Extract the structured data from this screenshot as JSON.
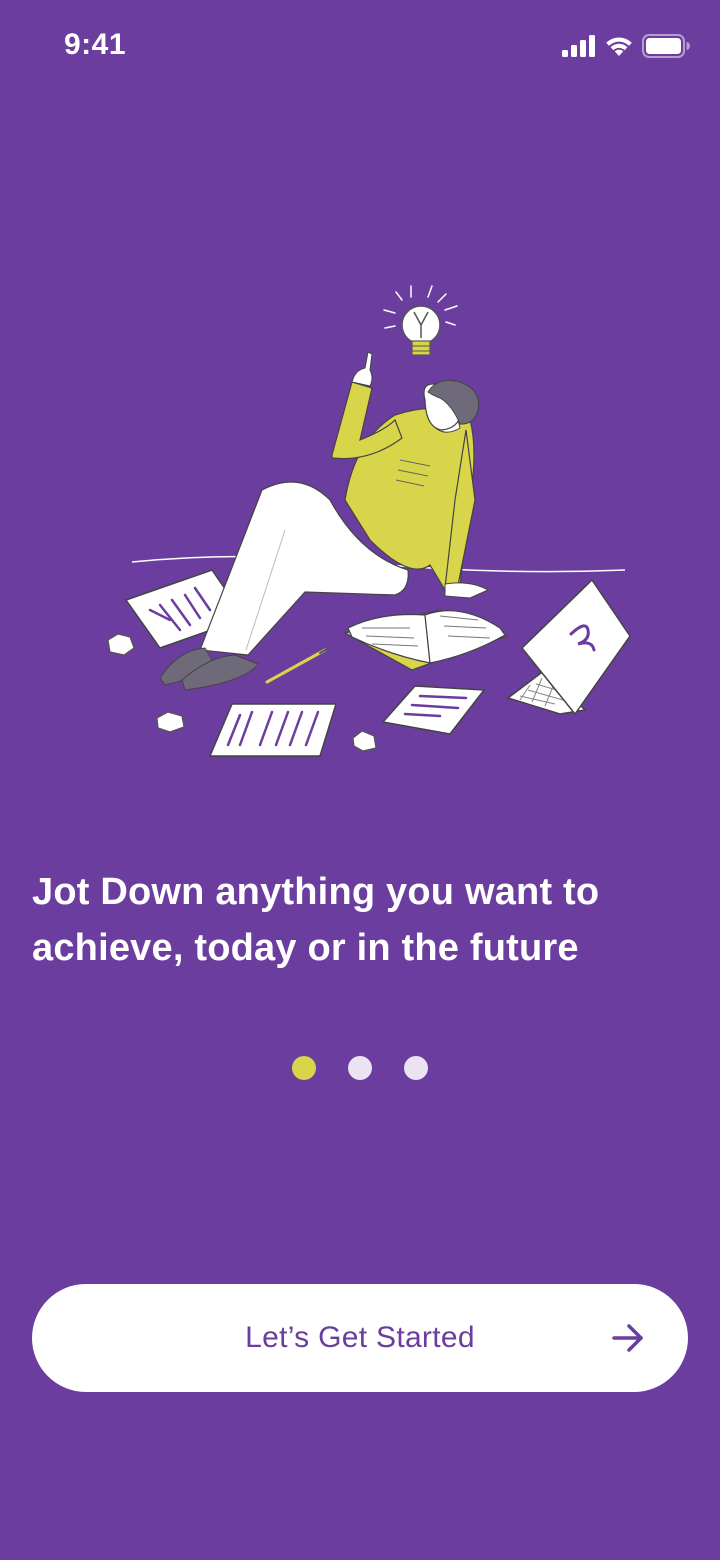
{
  "status_bar": {
    "time": "9:41",
    "icons": [
      "cellular-signal-icon",
      "wifi-icon",
      "battery-icon"
    ]
  },
  "illustration": {
    "name": "person-with-lightbulb-idea-illustration"
  },
  "onboarding": {
    "headline_line1": "Jot Down anything you want to",
    "headline_line2": "achieve, today or in the future",
    "page_indicator": {
      "total": 3,
      "current": 1
    }
  },
  "cta": {
    "label": "Let’s Get Started",
    "icon": "arrow-right-icon"
  },
  "colors": {
    "background": "#6A3D9E",
    "accent": "#D8D54A",
    "button_background": "#FFFFFF",
    "button_text": "#6A3D9E",
    "inactive_dot": "#EAE3F3"
  }
}
